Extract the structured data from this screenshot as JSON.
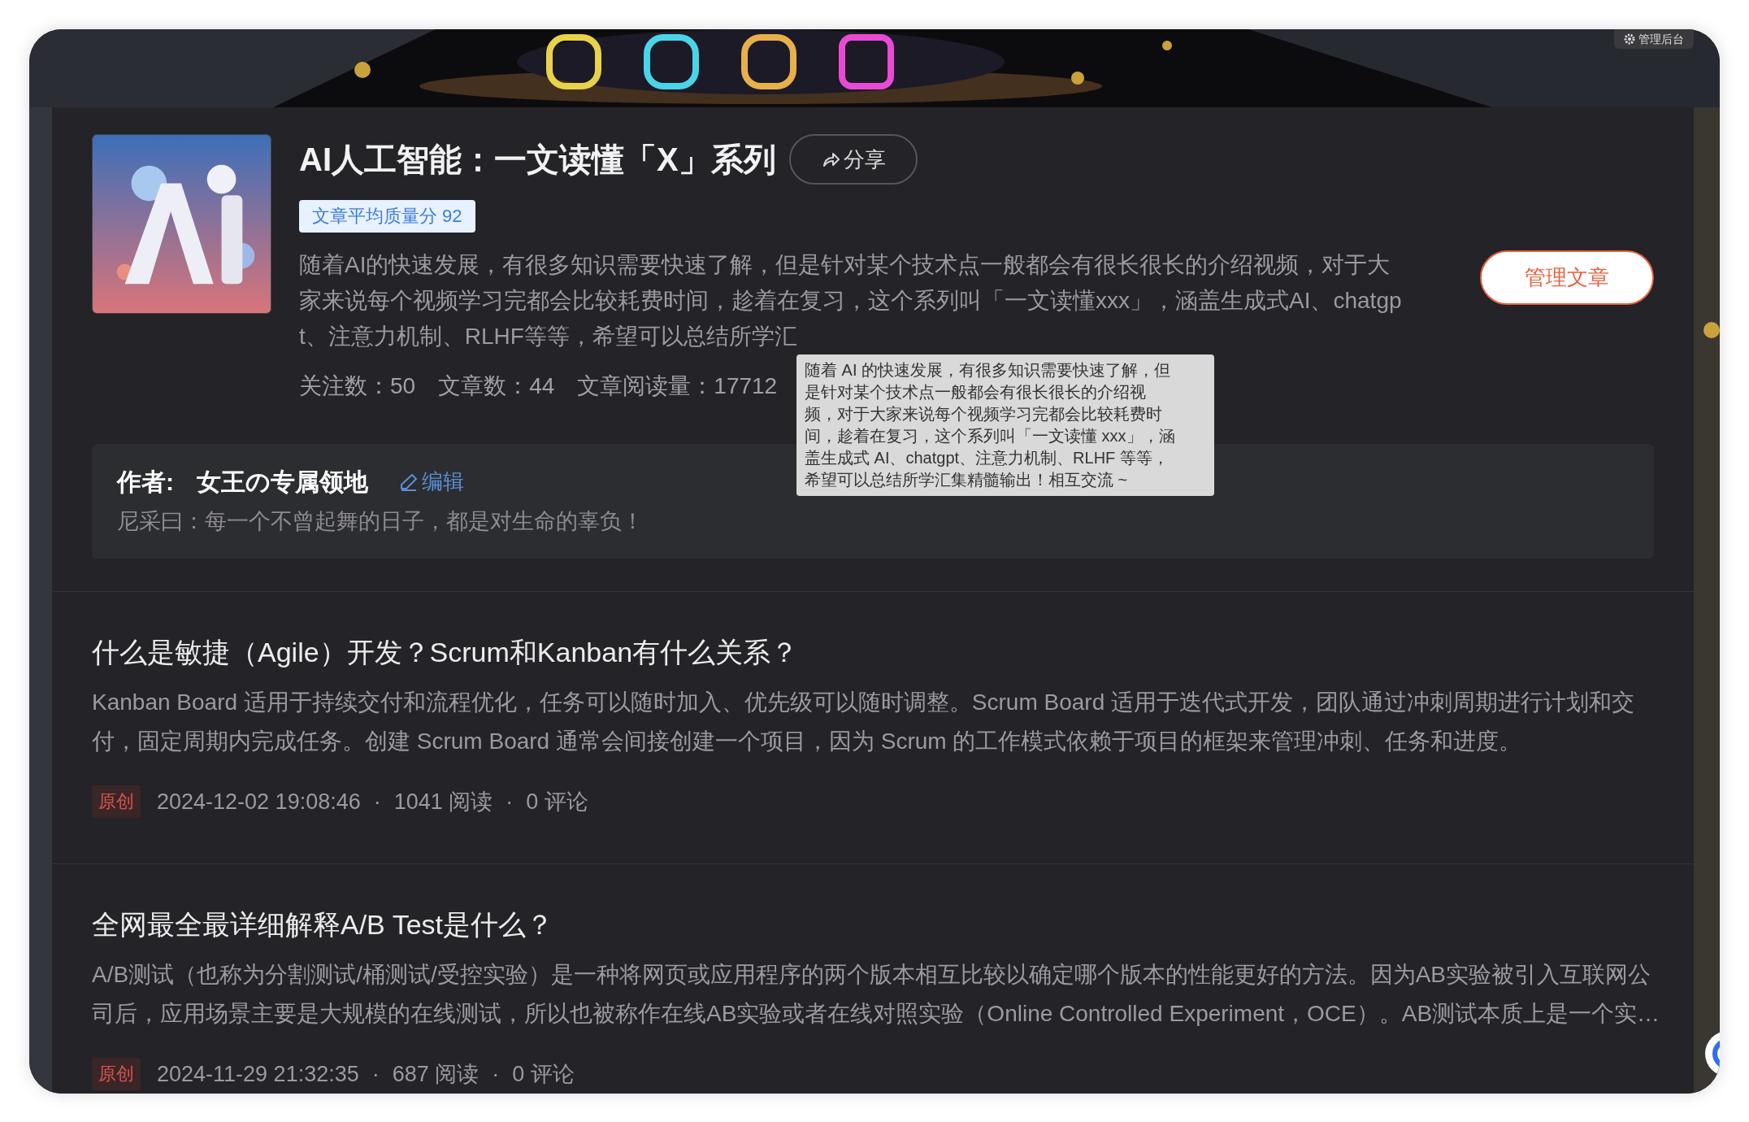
{
  "banner": {
    "admin_button": {
      "label": "管理后台"
    }
  },
  "series": {
    "title": "AI人工智能：一文读懂「X」系列",
    "share_button": "分享",
    "quality_badge": "文章平均质量分 92",
    "description_lines": [
      "随着AI的快速发展，有很多知识需要快速了解，但是针对某个技术点一般都会有很长很长的介绍视频，对于大",
      "家来说每个视频学习完都会比较耗费时间，趁着在复习，这个系列叫「一文读懂xxx」，涵盖生成式AI、chatgp",
      "t、注意力机制、RLHF等等，希望可以总结所学汇"
    ],
    "stats": [
      "关注数：50",
      "文章数：44",
      "文章阅读量：17712"
    ],
    "manage_button": "管理文章"
  },
  "tooltip": {
    "lines": [
      "随着 AI 的快速发展，有很多知识需要快速了解，但",
      "是针对某个技术点一般都会有很长很长的介绍视",
      "频，对于大家来说每个视频学习完都会比较耗费时",
      "间，趁着在复习，这个系列叫「一文读懂 xxx」，涵",
      "盖生成式 AI、chatgpt、注意力机制、RLHF 等等，",
      "希望可以总结所学汇集精髓输出！相互交流 ~"
    ]
  },
  "author": {
    "label": "作者:",
    "name": "女王の专属领地",
    "edit_link": "编辑",
    "motto": "尼采曰：每一个不曾起舞的日子，都是对生命的辜负！"
  },
  "articles": [
    {
      "title": "什么是敏捷（Agile）开发？Scrum和Kanban有什么关系？",
      "summary_lines": [
        "Kanban Board 适用于持续交付和流程优化，任务可以随时加入、优先级可以随时调整。Scrum Board 适用于迭代式开发，团队通过冲刺周期进行计划和交",
        "付，固定周期内完成任务。创建 Scrum Board 通常会间接创建一个项目，因为 Scrum 的工作模式依赖于项目的框架来管理冲刺、任务和进度。"
      ],
      "badge": "原创",
      "meta": [
        "2024-12-02 19:08:46",
        "1041 阅读",
        "0 评论"
      ],
      "separator": "·"
    },
    {
      "title": "全网最全最详细解释A/B Test是什么？",
      "summary_lines": [
        "A/B测试（也称为分割测试/桶测试/受控实验）是一种将网页或应用程序的两个版本相互比较以确定哪个版本的性能更好的方法。因为AB实验被引入互联网公",
        "司后，应用场景主要是大规模的在线测试，所以也被称作在线AB实验或者在线对照实验（Online Controlled Experiment，OCE）。AB测试本质上是一个实…"
      ],
      "badge": "原创",
      "meta": [
        "2024-11-29 21:32:35",
        "687 阅读",
        "0 评论"
      ],
      "separator": "·"
    }
  ]
}
